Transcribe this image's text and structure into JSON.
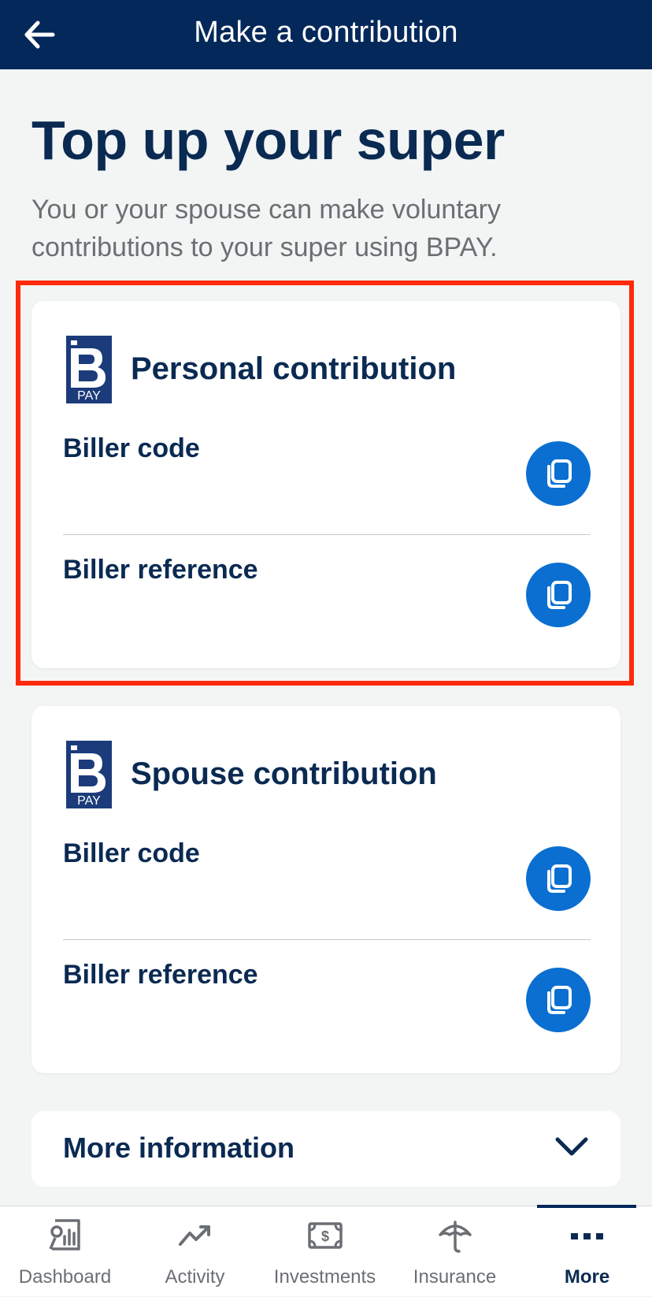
{
  "header": {
    "title": "Make a contribution"
  },
  "page": {
    "title": "Top up your super",
    "description": "You or your spouse can make voluntary contributions to your super using BPAY."
  },
  "cards": [
    {
      "title": "Personal contribution",
      "logo_text": "PAY",
      "fields": [
        {
          "label": "Biller code"
        },
        {
          "label": "Biller reference"
        }
      ]
    },
    {
      "title": "Spouse contribution",
      "logo_text": "PAY",
      "fields": [
        {
          "label": "Biller code"
        },
        {
          "label": "Biller reference"
        }
      ]
    }
  ],
  "more_info": {
    "label": "More information"
  },
  "tabs": [
    {
      "label": "Dashboard",
      "icon": "dashboard-chart-icon"
    },
    {
      "label": "Activity",
      "icon": "trend-arrow-icon"
    },
    {
      "label": "Investments",
      "icon": "dollar-note-icon"
    },
    {
      "label": "Insurance",
      "icon": "umbrella-icon"
    },
    {
      "label": "More",
      "icon": "more-dots-icon",
      "active": true
    }
  ],
  "colors": {
    "header_bg": "#04285a",
    "primary_text": "#0a2a52",
    "copy_button": "#0a6fd1",
    "highlight": "#ff2a0a"
  }
}
